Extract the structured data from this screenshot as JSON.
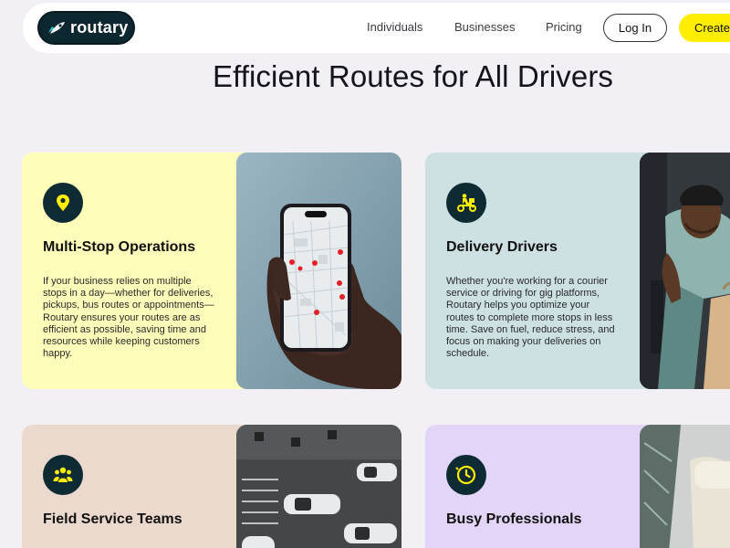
{
  "brand": {
    "name": "routary"
  },
  "nav": {
    "links": [
      "Individuals",
      "Businesses",
      "Pricing"
    ],
    "login_label": "Log In",
    "create_label": "Create"
  },
  "hero": {
    "title": "Efficient Routes for All Drivers"
  },
  "cards": [
    {
      "title": "Multi-Stop Operations",
      "icon": "location-pin-icon",
      "body": "If your business relies on multiple stops in a day—whether for deliveries, pickups, bus routes or appointments—Routary ensures your routes are as efficient as possible, saving time and resources while keeping customers happy."
    },
    {
      "title": "Delivery Drivers",
      "icon": "scooter-delivery-icon",
      "body": "Whether you're working for a courier service or driving for gig platforms, Routary helps you optimize your routes to complete more stops in less time. Save on fuel, reduce stress, and focus on making your deliveries on schedule."
    },
    {
      "title": "Field Service Teams",
      "icon": "team-icon",
      "body": ""
    },
    {
      "title": "Busy Professionals",
      "icon": "clock-icon",
      "body": ""
    }
  ],
  "colors": {
    "accent": "#ffee00",
    "brand_dark": "#0e2a33",
    "card1_bg": "#fffdba",
    "card2_bg": "#cde0e2",
    "card3_bg": "#ecd9ce",
    "card4_bg": "#e2d5f7"
  }
}
